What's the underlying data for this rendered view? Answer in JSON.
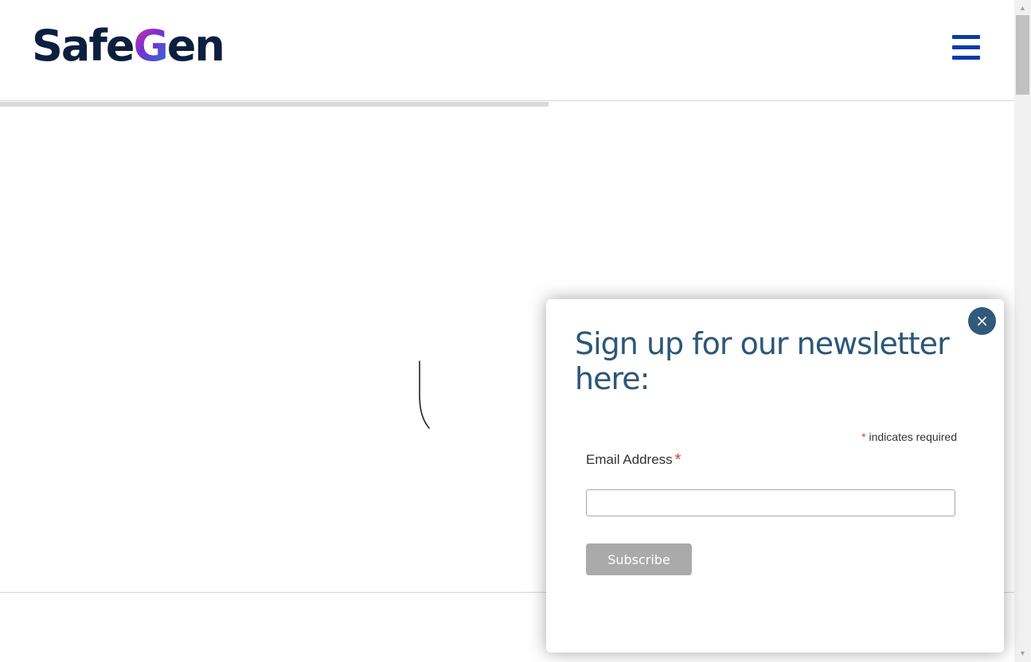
{
  "header": {
    "logo_text_part1": "Safe",
    "logo_text_g": "G",
    "logo_text_part2": "en",
    "menu_icon": "hamburger-menu-icon"
  },
  "page": {
    "loading_spinner_icon": "loading-spinner-icon"
  },
  "newsletter_modal": {
    "close_icon": "close-icon",
    "close_symbol": "×",
    "title": "Sign up for our newsletter here:",
    "required_asterisk": "*",
    "required_note": "indicates required",
    "email_label": "Email Address",
    "email_value": "",
    "subscribe_label": "Subscribe"
  },
  "scrollbar": {
    "up_arrow": "▲",
    "down_arrow": "▼"
  },
  "colors": {
    "brand_navy": "#0c1f3f",
    "menu_blue": "#0a3aa8",
    "modal_title": "#2c5777",
    "close_button": "#2f5a7c",
    "required_red": "#e0382e",
    "subscribe_disabled": "#aaaaaa"
  }
}
